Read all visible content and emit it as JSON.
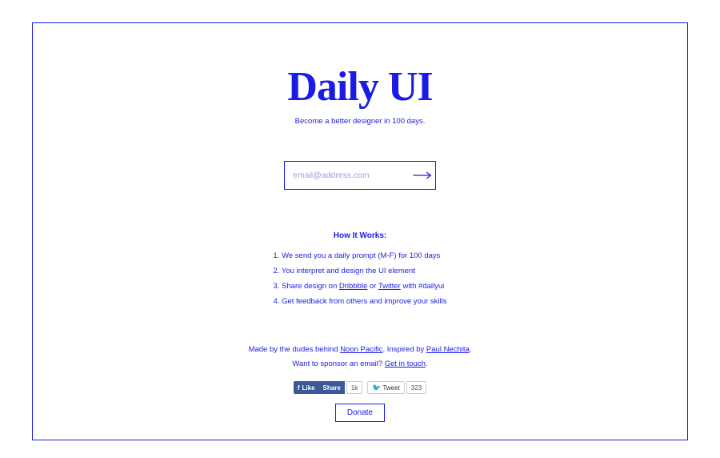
{
  "title": "Daily UI",
  "tagline": "Become a better designer in 100 days.",
  "signup": {
    "placeholder": "email@address.com"
  },
  "how": {
    "heading": "How It Works:",
    "steps": [
      "We send you a daily prompt (M-F) for 100 days",
      "You interpret and design the UI element",
      {
        "prefix": "Share design on ",
        "link1": "Dribbble",
        "mid": " or ",
        "link2": "Twitter",
        "suffix": " with #dailyui"
      },
      "Get feedback from others and improve your skills"
    ]
  },
  "footer": {
    "line1_prefix": "Made by the dudes behind ",
    "line1_link": "Noon Pacific",
    "line1_mid": ". Inspired by ",
    "line1_link2": "Paul Nechita",
    "line1_suffix": ".",
    "line2_prefix": "Want to sponsor an email? ",
    "line2_link": "Get in touch",
    "line2_suffix": "."
  },
  "social": {
    "fb_like": "Like",
    "fb_share": "Share",
    "fb_count": "1k",
    "tw_label": "Tweet",
    "tw_count": "323"
  },
  "donate": "Donate"
}
